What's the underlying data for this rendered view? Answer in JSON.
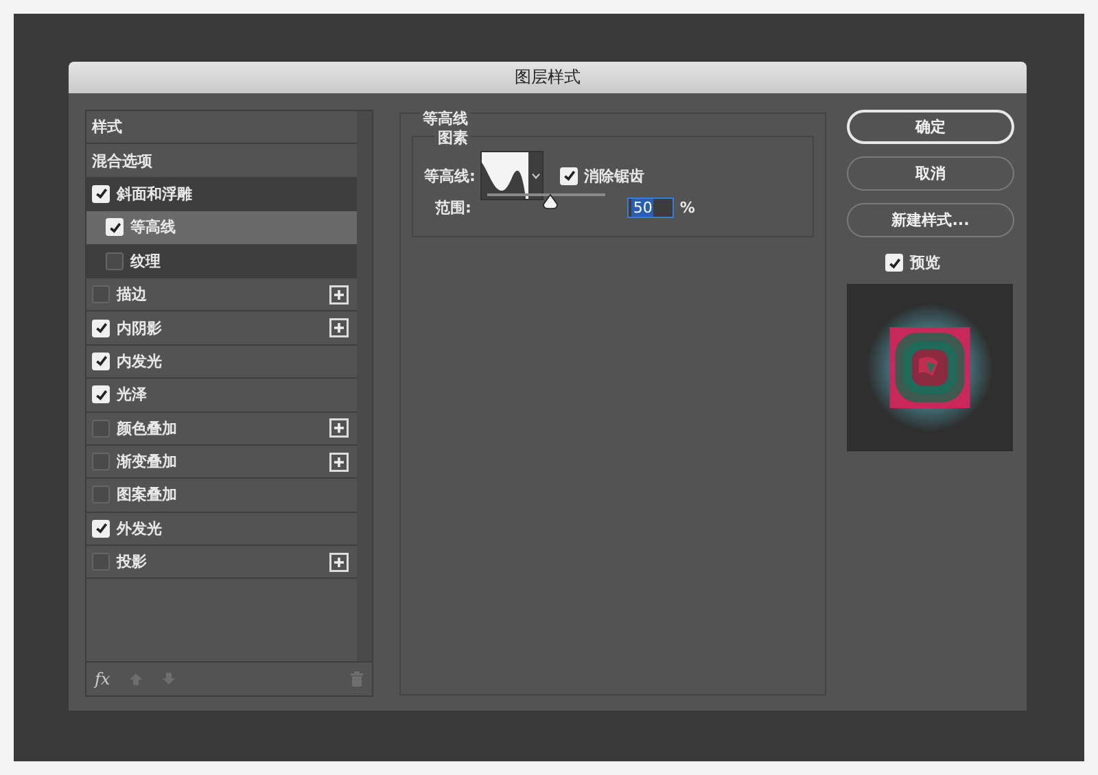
{
  "window": {
    "title": "图层样式"
  },
  "styles_list": {
    "items": [
      {
        "label": "样式",
        "kind": "plain",
        "selected": false
      },
      {
        "label": "混合选项",
        "kind": "plain",
        "selected": false
      },
      {
        "label": "斜面和浮雕",
        "kind": "check",
        "checked": true,
        "selected": false,
        "add": false,
        "children": [
          {
            "label": "等高线",
            "kind": "check",
            "checked": true,
            "selected": true,
            "add": false
          },
          {
            "label": "纹理",
            "kind": "check",
            "checked": false,
            "selected": false,
            "add": false
          }
        ]
      },
      {
        "label": "描边",
        "kind": "check",
        "checked": false,
        "selected": false,
        "add": true
      },
      {
        "label": "内阴影",
        "kind": "check",
        "checked": true,
        "selected": false,
        "add": true
      },
      {
        "label": "内发光",
        "kind": "check",
        "checked": true,
        "selected": false,
        "add": false
      },
      {
        "label": "光泽",
        "kind": "check",
        "checked": true,
        "selected": false,
        "add": false
      },
      {
        "label": "颜色叠加",
        "kind": "check",
        "checked": false,
        "selected": false,
        "add": true
      },
      {
        "label": "渐变叠加",
        "kind": "check",
        "checked": false,
        "selected": false,
        "add": true
      },
      {
        "label": "图案叠加",
        "kind": "check",
        "checked": false,
        "selected": false,
        "add": false
      },
      {
        "label": "外发光",
        "kind": "check",
        "checked": true,
        "selected": false,
        "add": false
      },
      {
        "label": "投影",
        "kind": "check",
        "checked": false,
        "selected": false,
        "add": true
      }
    ],
    "toolbar": {
      "fx": "fx"
    }
  },
  "contour_panel": {
    "title": "等高线",
    "group": "图素",
    "contour_label": "等高线:",
    "anti_alias": {
      "label": "消除锯齿",
      "checked": true
    },
    "range_label": "范围:",
    "range": {
      "level": 0.5,
      "value": "50",
      "unit": "%"
    }
  },
  "buttons": [
    {
      "label": "确定",
      "primary": true
    },
    {
      "label": "取消",
      "primary": false
    },
    {
      "label": "新建样式...",
      "primary": false
    }
  ],
  "preview": {
    "label": "预览",
    "checked": true,
    "kind": "picture"
  }
}
